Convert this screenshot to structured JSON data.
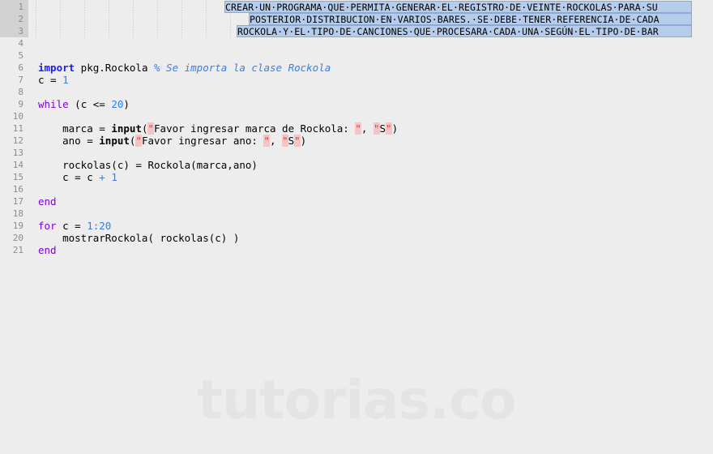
{
  "editor": {
    "title": "code-editor",
    "background_color": "#ededed",
    "gutter_color": "#ededed",
    "gutter_highlight_color": "#d2d2d2",
    "selection_color": "#b5cdeb",
    "selection_border_color": "#8eaad0",
    "watermark": "tutorias.co",
    "watermark_color": "#e4e4e4",
    "line_numbers": [
      "1",
      "2",
      "3",
      "4",
      "5",
      "6",
      "7",
      "8",
      "9",
      "10",
      "11",
      "12",
      "13",
      "14",
      "15",
      "16",
      "17",
      "18",
      "19",
      "20",
      "21"
    ]
  },
  "prompt": {
    "selected": true,
    "line1": "CREAR·UN·PROGRAMA·QUE·PERMITA·GENERAR·EL·REGISTRO·DE·VEINTE·ROCKOLAS·PARA·SU",
    "line2": "POSTERIOR·DISTRIBUCION·EN·VARIOS·BARES.·SE·DEBE·TENER·REFERENCIA·DE·CADA",
    "line3": "ROCKOLA·Y·EL·TIPO·DE·CANCIONES·QUE·PROCESARA·CADA·UNA·SEGÚN·EL·TIPO·DE·BAR",
    "plain1": "CREAR UN PROGRAMA QUE PERMITA GENERAR EL REGISTRO DE VEINTE ROCKOLAS PARA SU",
    "plain2": "POSTERIOR DISTRIBUCION EN VARIOS BARES. SE DEBE TENER REFERENCIA DE CADA",
    "plain3": "ROCKOLA Y EL TIPO DE CANCIONES QUE PROCESARA CADA UNA SEGÚN EL TIPO DE BAR"
  },
  "code": {
    "line6": {
      "kw": "import",
      "target": " pkg.Rockola ",
      "comment": "% Se importa la clase Rockola"
    },
    "line7": {
      "text": "c = ",
      "num": "1"
    },
    "line9": {
      "kw": "while",
      "mid": " (c <= ",
      "num": "20",
      "tail": ")"
    },
    "line11": {
      "lhs": "    marca = ",
      "fn": "input",
      "open": "(",
      "q1": "\"",
      "str": "Favor ingresar marca de Rockola: ",
      "q2": "\"",
      "comma": ", ",
      "q3": "\"",
      "flag": "S",
      "q4": "\"",
      "close": ")"
    },
    "line12": {
      "lhs": "    ano = ",
      "fn": "input",
      "open": "(",
      "q1": "\"",
      "str": "Favor ingresar ano: ",
      "q2": "\"",
      "comma": ", ",
      "q3": "\"",
      "flag": "S",
      "q4": "\"",
      "close": ")"
    },
    "line14": {
      "text": "    rockolas(c) = Rockola(marca,ano)"
    },
    "line15": {
      "pre": "    c = c ",
      "op": "+",
      "mid": " ",
      "num": "1"
    },
    "line17": {
      "kw": "end"
    },
    "line19": {
      "kw": "for",
      "mid": " c = ",
      "num": "1:20"
    },
    "line20": {
      "text": "    mostrarRockola( rockolas(c) )"
    },
    "line21": {
      "kw": "end"
    }
  }
}
